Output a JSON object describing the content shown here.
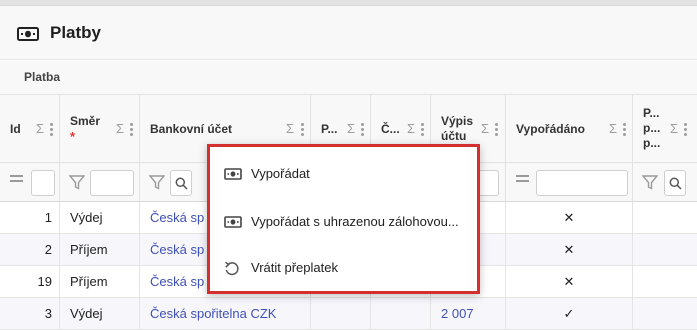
{
  "header": {
    "title": "Platby",
    "icon": "money-icon"
  },
  "section": {
    "label": "Platba"
  },
  "columns": [
    {
      "id": "id",
      "label": "Id"
    },
    {
      "id": "smer",
      "label": "Směr",
      "required_mark": "*"
    },
    {
      "id": "bankovni_ucet",
      "label": "Bankovní účet"
    },
    {
      "id": "p_col",
      "label": "P..."
    },
    {
      "id": "c_col",
      "label": "Č..."
    },
    {
      "id": "vypis",
      "label_line1": "Výpis",
      "label_line2": "účtu"
    },
    {
      "id": "vyporadano",
      "label": "Vypořádáno"
    },
    {
      "id": "p_last",
      "label_lines": [
        "P...",
        "p...",
        "p..."
      ]
    }
  ],
  "column_icons": {
    "sort": "Σ",
    "filter": "funnel-icon",
    "search": "search-icon",
    "equals": "equals-icon",
    "menu": "more-vert-icon"
  },
  "rows": [
    {
      "id": "1",
      "smer": "Výdej",
      "ucet": "Česká sp",
      "vypis": "",
      "vyporadano": "✕"
    },
    {
      "id": "2",
      "smer": "Příjem",
      "ucet": "Česká sp",
      "vypis": "",
      "vyporadano": "✕"
    },
    {
      "id": "19",
      "smer": "Příjem",
      "ucet": "Česká sp",
      "vypis": "",
      "vyporadano": "✕"
    },
    {
      "id": "3",
      "smer": "Výdej",
      "ucet": "Česká spořitelna CZK",
      "vypis": "2 007",
      "vyporadano": "✓"
    }
  ],
  "context_menu": {
    "items": [
      {
        "label": "Vypořádat",
        "icon": "money-icon"
      },
      {
        "label": "Vypořádat s uhrazenou zálohovou...",
        "icon": "money-icon"
      },
      {
        "label": "Vrátit přeplatek",
        "icon": "undo-icon"
      }
    ],
    "highlight_color": "#d32f2f"
  },
  "colors": {
    "link": "#3f51b5",
    "required": "#e53935",
    "header_bg": "#f8f8f8"
  }
}
